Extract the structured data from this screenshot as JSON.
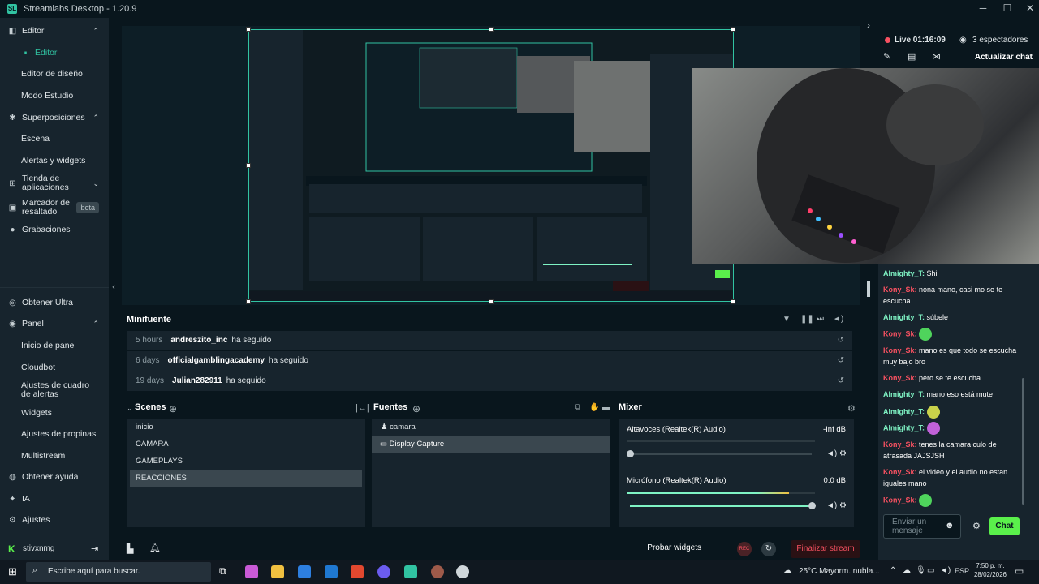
{
  "app": {
    "title": "Streamlabs Desktop - 1.20.9",
    "logo": "SL"
  },
  "window": {
    "minimize": "─",
    "maximize": "☐",
    "close": "✕"
  },
  "sidebar": {
    "items": [
      {
        "label": "Editor",
        "type": "section",
        "icon": "editor-icon",
        "chev": "⌃"
      },
      {
        "label": "Editor",
        "type": "sub",
        "active": true,
        "icon": "editor-active-icon"
      },
      {
        "label": "Editor de diseño",
        "type": "sub"
      },
      {
        "label": "Modo Estudio",
        "type": "sub"
      },
      {
        "label": "Superposiciones",
        "type": "section",
        "icon": "overlays-icon",
        "chev": "⌃"
      },
      {
        "label": "Escena",
        "type": "sub"
      },
      {
        "label": "Alertas y widgets",
        "type": "sub"
      },
      {
        "label": "Tienda de aplicaciones",
        "type": "section",
        "icon": "store-icon",
        "chev": "⌄"
      },
      {
        "label": "Marcador de resaltado",
        "type": "section",
        "icon": "highlighter-icon",
        "badge": "beta"
      },
      {
        "label": "Grabaciones",
        "type": "section",
        "icon": "recordings-icon"
      },
      {
        "label": "Obtener Ultra",
        "type": "section",
        "icon": "ultra-icon"
      },
      {
        "label": "Panel",
        "type": "section",
        "icon": "dashboard-icon",
        "chev": "⌃"
      },
      {
        "label": "Inicio de panel",
        "type": "sub"
      },
      {
        "label": "Cloudbot",
        "type": "sub"
      },
      {
        "label": "Ajustes de cuadro de alertas",
        "type": "sub"
      },
      {
        "label": "Widgets",
        "type": "sub"
      },
      {
        "label": "Ajustes de propinas",
        "type": "sub"
      },
      {
        "label": "Multistream",
        "type": "sub"
      },
      {
        "label": "Obtener ayuda",
        "type": "section",
        "icon": "help-icon"
      },
      {
        "label": "IA",
        "type": "section",
        "icon": "ai-icon"
      },
      {
        "label": "Ajustes",
        "type": "section",
        "icon": "settings-icon"
      }
    ],
    "user": "stivxnmg",
    "logout_icon": "⇥",
    "collapse_icon": "‹"
  },
  "stream": {
    "live": "Live 01:16:09",
    "viewers": "3 espectadores",
    "refresh_chat": "Actualizar chat",
    "expand_icon": "›"
  },
  "chat": {
    "messages": [
      {
        "user": "Almighty_T",
        "text": "Shi",
        "color": "nm2"
      },
      {
        "user": "Kony_Sk",
        "text": "nona mano, casi mo se te escucha",
        "color": "nm1"
      },
      {
        "user": "Almighty_T",
        "text": "súbele",
        "color": "nm2"
      },
      {
        "user": "Kony_Sk",
        "text": "",
        "emote": "#4fd45c",
        "color": "nm1"
      },
      {
        "user": "Kony_Sk",
        "text": "mano es que todo se escucha muy bajo bro",
        "color": "nm1"
      },
      {
        "user": "Kony_Sk",
        "text": "pero se te escucha",
        "color": "nm1"
      },
      {
        "user": "Almighty_T",
        "text": "mano eso está mute",
        "color": "nm2"
      },
      {
        "user": "Almighty_T",
        "text": "",
        "emote": "#c9d24a",
        "color": "nm2"
      },
      {
        "user": "Almighty_T",
        "text": "",
        "emote": "#c061d8",
        "color": "nm2"
      },
      {
        "user": "Kony_Sk",
        "text": "tenes la camara culo de atrasada JAJSJSH",
        "color": "nm1"
      },
      {
        "user": "Kony_Sk",
        "text": "el video y el audio no estan iguales mano",
        "color": "nm1"
      },
      {
        "user": "Kony_Sk",
        "text": "",
        "emote": "#4fd45c",
        "color": "nm1"
      }
    ],
    "input_placeholder": "Enviar un mensaje",
    "send": "Chat"
  },
  "minifuente": {
    "title": "Minifuente",
    "rows": [
      {
        "when": "5 hours",
        "who": "andreszito_inc",
        "action": "ha seguido"
      },
      {
        "when": "6 days",
        "who": "officialgamblingacademy",
        "action": "ha seguido"
      },
      {
        "when": "19 days",
        "who": "Julian282911",
        "action": "ha seguido"
      }
    ]
  },
  "scenes": {
    "title": "Scenes",
    "items": [
      "inicio",
      "CAMARA",
      "GAMEPLAYS",
      "REACCIONES"
    ],
    "selected": 3
  },
  "sources": {
    "title": "Fuentes",
    "items": [
      "camara",
      "Display Capture"
    ],
    "selected": 1
  },
  "mixer": {
    "title": "Mixer",
    "channels": [
      {
        "name": "Altavoces (Realtek(R) Audio)",
        "db": "-Inf dB",
        "level": 0.0,
        "volume": 0.0
      },
      {
        "name": "Micrófono (Realtek(R) Audio)",
        "db": "0.0 dB",
        "level": 0.86,
        "volume": 1.0
      }
    ]
  },
  "footer": {
    "probar": "Probar widgets",
    "rec": "REC",
    "finalizar": "Finalizar stream"
  },
  "taskbar": {
    "search": "Escribe aquí para buscar.",
    "weather": "25°C  Mayorm. nubla...",
    "lang": "ESP",
    "time": "7:50 p. m.",
    "date": "28/02/2026"
  }
}
